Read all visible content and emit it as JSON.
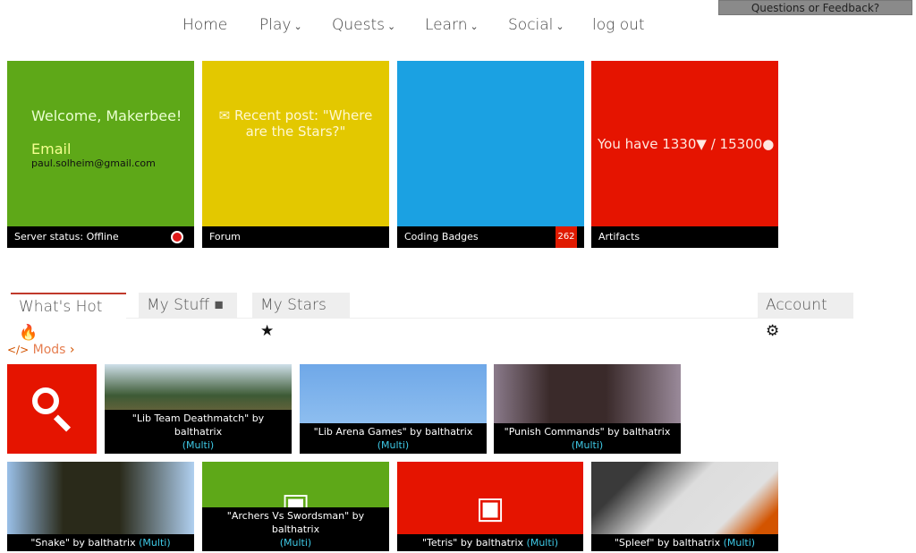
{
  "feedback_label": "Questions or Feedback?",
  "nav": [
    {
      "label": "Home",
      "dropdown": false
    },
    {
      "label": "Play",
      "dropdown": true
    },
    {
      "label": "Quests",
      "dropdown": true
    },
    {
      "label": "Learn",
      "dropdown": true
    },
    {
      "label": "Social",
      "dropdown": true
    },
    {
      "label": "log out",
      "dropdown": false
    }
  ],
  "tiles": {
    "welcome": {
      "title": "Welcome, Makerbee!",
      "email_label": "Email",
      "email": "paul.solheim@gmail.com",
      "bar": "Server status: Offline",
      "color": "#5ea818",
      "status_color": "#e01a1a"
    },
    "forum": {
      "text": "Recent post: \"Where are the Stars?\"",
      "bar": "Forum",
      "color": "#e3c800",
      "icon": "envelope-icon"
    },
    "badges": {
      "bar": "Coding Badges",
      "count": "262",
      "color": "#1ba1e2"
    },
    "artifacts": {
      "prefix": "You have ",
      "gems": "1330",
      "sep": " / ",
      "points": "15300",
      "bar": "Artifacts",
      "color": "#e51400"
    }
  },
  "tabs": [
    {
      "label": "What's Hot",
      "icon": "fire-icon",
      "active": true
    },
    {
      "label": "My Stuff",
      "icon": "cube-icon"
    },
    {
      "label": "My Stars",
      "icon": "star-icon"
    }
  ],
  "account_label": "Account",
  "section": {
    "label": "Mods"
  },
  "mods": [
    {
      "title": "\"Lib Team Deathmatch\" by balthatrix",
      "tag": "(Multi)"
    },
    {
      "title": "\"Lib Arena Games\" by balthatrix",
      "tag": "(Multi)"
    },
    {
      "title": "\"Punish Commands\" by balthatrix",
      "tag": "(Multi)"
    },
    {
      "title": "\"Snake\" by balthatrix",
      "tag": "(Multi)"
    },
    {
      "title": "\"Archers Vs Swordsman\" by balthatrix",
      "tag": "(Multi)"
    },
    {
      "title": "\"Tetris\" by balthatrix",
      "tag": "(Multi)"
    },
    {
      "title": "\"Spleef\" by balthatrix",
      "tag": "(Multi)"
    }
  ]
}
